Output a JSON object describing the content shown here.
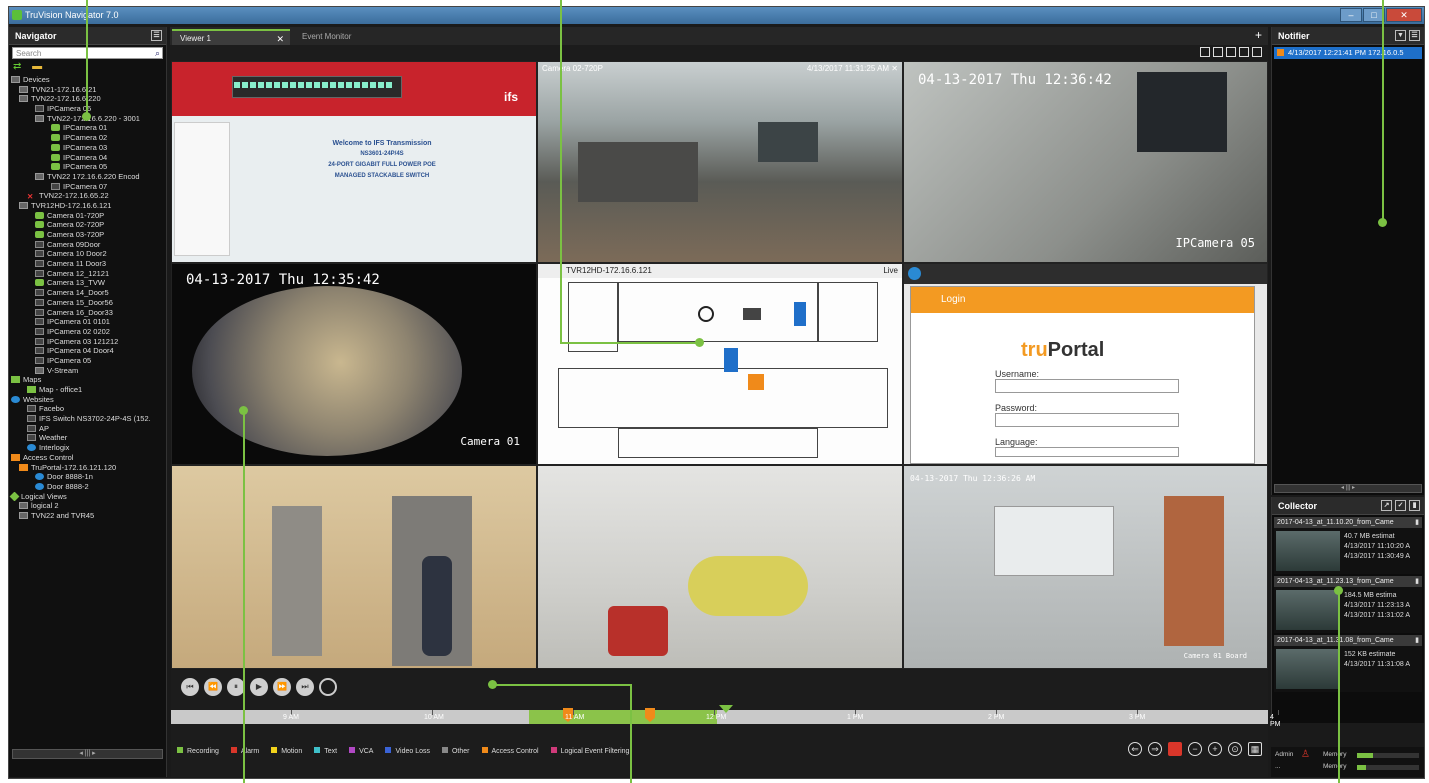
{
  "app": {
    "title": "TruVision Navigator 7.0"
  },
  "navigator": {
    "title": "Navigator",
    "search_placeholder": "Search",
    "tree": [
      {
        "label": "Devices",
        "icon": "dev",
        "indent": 0
      },
      {
        "label": "TVN21-172.16.6.21",
        "icon": "dev",
        "indent": 1
      },
      {
        "label": "TVN22-172.16.6.220",
        "icon": "dev",
        "indent": 1
      },
      {
        "label": "IPCamera 06",
        "icon": "camg",
        "indent": 3
      },
      {
        "label": "TVN22-172.16.6.220 - 3001",
        "icon": "dev",
        "indent": 3
      },
      {
        "label": "IPCamera 01",
        "icon": "cam",
        "indent": 5
      },
      {
        "label": "IPCamera 02",
        "icon": "cam",
        "indent": 5
      },
      {
        "label": "IPCamera 03",
        "icon": "cam",
        "indent": 5
      },
      {
        "label": "IPCamera 04",
        "icon": "cam",
        "indent": 5
      },
      {
        "label": "IPCamera 05",
        "icon": "cam",
        "indent": 5
      },
      {
        "label": "TVN22 172.16.6.220 Encod",
        "icon": "dev",
        "indent": 3
      },
      {
        "label": "IPCamera 07",
        "icon": "camg",
        "indent": 5
      },
      {
        "label": "TVN22-172.16.65.22",
        "icon": "err",
        "indent": 2
      },
      {
        "label": "TVR12HD-172.16.6.121",
        "icon": "dev",
        "indent": 1
      },
      {
        "label": "Camera 01-720P",
        "icon": "cam",
        "indent": 3
      },
      {
        "label": "Camera 02-720P",
        "icon": "cam",
        "indent": 3
      },
      {
        "label": "Camera 03-720P",
        "icon": "cam",
        "indent": 3
      },
      {
        "label": "Camera 09Door",
        "icon": "camg",
        "indent": 3
      },
      {
        "label": "Camera 10 Door2",
        "icon": "camg",
        "indent": 3
      },
      {
        "label": "Camera 11 Door3",
        "icon": "camg",
        "indent": 3
      },
      {
        "label": "Camera 12_12121",
        "icon": "camg",
        "indent": 3
      },
      {
        "label": "Camera 13_TVW",
        "icon": "cam",
        "indent": 3
      },
      {
        "label": "Camera 14_Door5",
        "icon": "camg",
        "indent": 3
      },
      {
        "label": "Camera 15_Door56",
        "icon": "camg",
        "indent": 3
      },
      {
        "label": "Camera 16_Door33",
        "icon": "camg",
        "indent": 3
      },
      {
        "label": "IPCamera 01 0101",
        "icon": "camg",
        "indent": 3
      },
      {
        "label": "IPCamera 02 0202",
        "icon": "camg",
        "indent": 3
      },
      {
        "label": "IPCamera 03 121212",
        "icon": "camg",
        "indent": 3
      },
      {
        "label": "IPCamera 04 Door4",
        "icon": "camg",
        "indent": 3
      },
      {
        "label": "IPCamera 05",
        "icon": "camg",
        "indent": 3
      },
      {
        "label": "V-Stream",
        "icon": "dev",
        "indent": 3
      },
      {
        "label": "Maps",
        "icon": "map",
        "indent": 0
      },
      {
        "label": "Map - office1",
        "icon": "map",
        "indent": 2
      },
      {
        "label": "Websites",
        "icon": "web",
        "indent": 0
      },
      {
        "label": "Facebo",
        "icon": "camg",
        "indent": 2
      },
      {
        "label": "IFS Switch NS3702-24P-4S (152.",
        "icon": "camg",
        "indent": 2
      },
      {
        "label": "AP",
        "icon": "camg",
        "indent": 2
      },
      {
        "label": "Weather",
        "icon": "camg",
        "indent": 2
      },
      {
        "label": "Interlogix",
        "icon": "web",
        "indent": 2
      },
      {
        "label": "Access Control",
        "icon": "ac",
        "indent": 0
      },
      {
        "label": "TruPortal-172.16.121.120",
        "icon": "ac",
        "indent": 1
      },
      {
        "label": "Door 8888-1n",
        "icon": "web",
        "indent": 3
      },
      {
        "label": "Door 8888-2",
        "icon": "web",
        "indent": 3
      },
      {
        "label": "Logical Views",
        "icon": "lv",
        "indent": 0
      },
      {
        "label": "logical 2",
        "icon": "dev",
        "indent": 1
      },
      {
        "label": "TVN22 and TVR45",
        "icon": "dev",
        "indent": 1
      }
    ]
  },
  "tabs": {
    "viewer": "Viewer 1",
    "event_monitor": "Event Monitor",
    "close": "✕",
    "add": "+"
  },
  "tiles": {
    "web": {
      "logo": "ifs",
      "welcome_lines": [
        "Welcome to IFS Transmission",
        "NS3601-24P/4S",
        "24-PORT GIGABIT FULL POWER POE",
        "MANAGED STACKABLE SWITCH"
      ]
    },
    "cam_office": {
      "left": "Camera 02-720P",
      "right": "4/13/2017 11:31:25 AM",
      "close": "✕"
    },
    "cam_hall": {
      "osd_time": "04-13-2017 Thu 12:36:42",
      "osd_name": "IPCamera 05"
    },
    "fisheye": {
      "osd_time": "04-13-2017 Thu 12:35:42",
      "osd_name": "Camera 01"
    },
    "map": {
      "left": "TVR12HD-172.16.6.121",
      "right": "Live"
    },
    "truportal": {
      "header": "Login",
      "logo_prefix": "tru",
      "logo_suffix": "Portal",
      "username": "Username:",
      "password": "Password:",
      "language": "Language:"
    },
    "atrium_osd": "",
    "room": {
      "osd_time": "04-13-2017 Thu 12:36:26 AM",
      "osd_name": "Camera 01 Board"
    }
  },
  "notifier": {
    "title": "Notifier",
    "rows": [
      "4/13/2017 12:21:41 PM  172.16.0.5"
    ]
  },
  "collector": {
    "title": "Collector",
    "groups": [
      {
        "header": "2017-04-13_at_11.10.20_from_Came",
        "size": "40.7 MB estimat",
        "start": "4/13/2017 11:10:20 A",
        "end": "4/13/2017 11:30:49 A"
      },
      {
        "header": "2017-04-13_at_11.23.13_from_Came",
        "size": "184.5 MB estima",
        "start": "4/13/2017 11:23:13 A",
        "end": "4/13/2017 11:31:02 A"
      },
      {
        "header": "2017-04-13_at_11.31.08_from_Came",
        "size": "152 KB estimate",
        "start": "4/13/2017 11:31:08 A",
        "end": ""
      }
    ]
  },
  "timeline": {
    "labels": [
      "9 AM",
      "10 AM",
      "11 AM",
      "12 PM",
      "1 PM",
      "2 PM",
      "3 PM",
      "4 PM"
    ],
    "legend": [
      {
        "label": "Recording",
        "color": "#7bc143"
      },
      {
        "label": "Alarm",
        "color": "#d9362a"
      },
      {
        "label": "Motion",
        "color": "#f2d31b"
      },
      {
        "label": "Text",
        "color": "#3fc0c9"
      },
      {
        "label": "VCA",
        "color": "#b148c4"
      },
      {
        "label": "Video Loss",
        "color": "#3a63d6"
      },
      {
        "label": "Other",
        "color": "#888888"
      },
      {
        "label": "Access Control",
        "color": "#f08a1a"
      },
      {
        "label": "Logical Event Filtering",
        "color": "#d03a7a"
      }
    ]
  },
  "status": {
    "admin": "Admin",
    "row2": "...",
    "mem_label": "Memory",
    "cpu_label": "Memory",
    "mem_level": 0.15,
    "cpu_level": 0.25
  }
}
